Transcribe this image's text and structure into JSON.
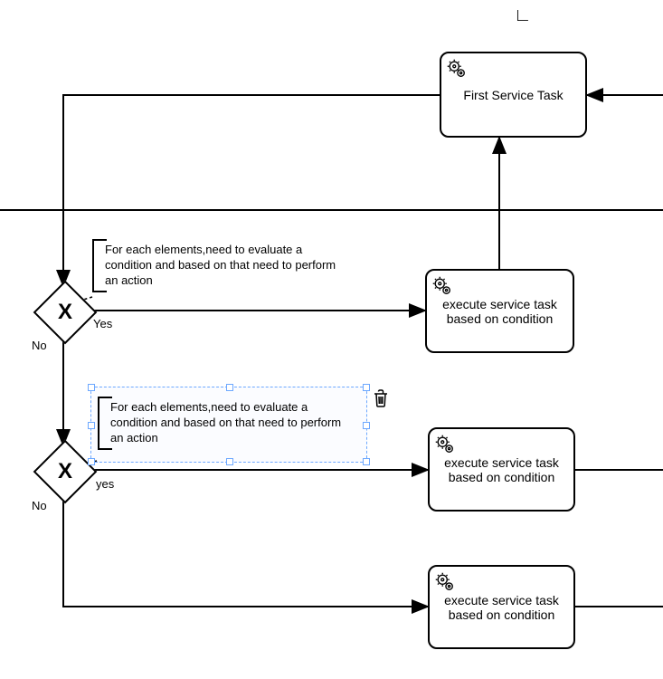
{
  "cornerMark": "∟",
  "tasks": {
    "firstServiceTask": "First Service Task",
    "execTask1": "execute service task based on condition",
    "execTask2": "execute service task based on condition",
    "execTask3": "execute service task based on condition"
  },
  "gateways": {
    "g1": {
      "label_no": "No",
      "label_yes": "Yes"
    },
    "g2": {
      "label_no": "No",
      "label_yes": "yes"
    }
  },
  "annotations": {
    "a1": "For each elements,need to evaluate a condition and based on that need to perform an action",
    "a2": "For each elements,need to evaluate a condition and based on that need to perform an action"
  },
  "icons": {
    "gear": "gear-icon",
    "trash": "trash-icon",
    "gateway_x": "X"
  }
}
